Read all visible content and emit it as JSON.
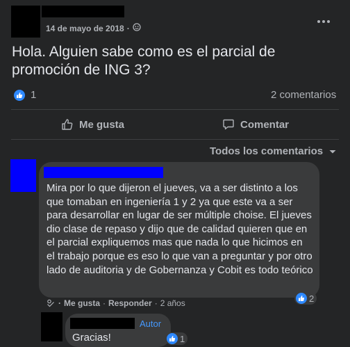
{
  "post": {
    "date": "14 de mayo de 2018",
    "privacy_separator": "·",
    "text_line1": "Hola. Alguien sabe como es el parcial de",
    "text_line2": "promoción de ING 3?",
    "reaction_count": "1",
    "comments_count": "2 comentarios",
    "more_icon": "more-horizontal-icon"
  },
  "actions": {
    "like": "Me gusta",
    "comment": "Comentar"
  },
  "filter": {
    "label": "Todos los comentarios"
  },
  "comment1": {
    "text": "Mira por lo que dijeron el jueves, va a ser distinto a los que tomaban en ingeniería 1 y 2 ya que este va a ser para desarrollar en lugar de ser múltiple choise. El jueves dio clase de repaso y dijo que de calidad quieren que en el parcial expliquemos mas que nada lo que hicimos en el trabajo porque es eso lo que van a preguntar y por otro lado de auditoria y de Gobernanza y Cobit es todo teórico",
    "like": "Me gusta",
    "reply": "Responder",
    "time": "2 años",
    "sep": "·",
    "reaction_count": "2"
  },
  "comment2": {
    "author_badge": "Autor",
    "text": "Gracias!",
    "reaction_count": "1"
  },
  "colors": {
    "background": "#242526",
    "bubble": "#3a3b3c",
    "accent": "#2e89ff"
  }
}
